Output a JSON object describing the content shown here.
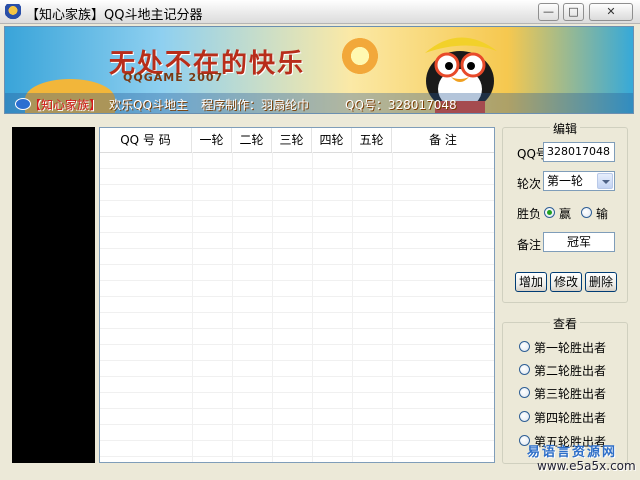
{
  "window": {
    "title": "【知心家族】QQ斗地主记分器",
    "controls": {
      "minimize": "—",
      "maximize": "□",
      "close": "✕"
    }
  },
  "banner": {
    "slogan": "无处不在的快乐",
    "subtitle": "QQGAME 2007",
    "brand": "【知心家族】",
    "welcome": "欢乐QQ斗地主",
    "credit": "程序制作：羽扇纶巾",
    "qq": "QQ号：328017048"
  },
  "table": {
    "columns": [
      "QQ 号 码",
      "一轮",
      "二轮",
      "三轮",
      "四轮",
      "五轮",
      "备  注"
    ],
    "rows": []
  },
  "edit": {
    "title": "编辑",
    "qq_label": "QQ号",
    "qq_value": "328017048",
    "round_label": "轮次",
    "round_value": "第一轮",
    "result_label": "胜负",
    "win_label": "赢",
    "lose_label": "输",
    "result_selected": "win",
    "note_label": "备注",
    "note_value": "冠军",
    "add_button": "增加",
    "modify_button": "修改",
    "delete_button": "删除"
  },
  "view": {
    "title": "查看",
    "options": [
      "第一轮胜出者",
      "第二轮胜出者",
      "第三轮胜出者",
      "第四轮胜出者",
      "第五轮胜出者"
    ]
  },
  "watermark": {
    "line1": "易语言资源网",
    "line2": "www.e5a5x.com"
  },
  "colors": {
    "accent": "#2c6fd1",
    "brand_red": "#d41c1c",
    "radio_selected": "#21a121"
  }
}
